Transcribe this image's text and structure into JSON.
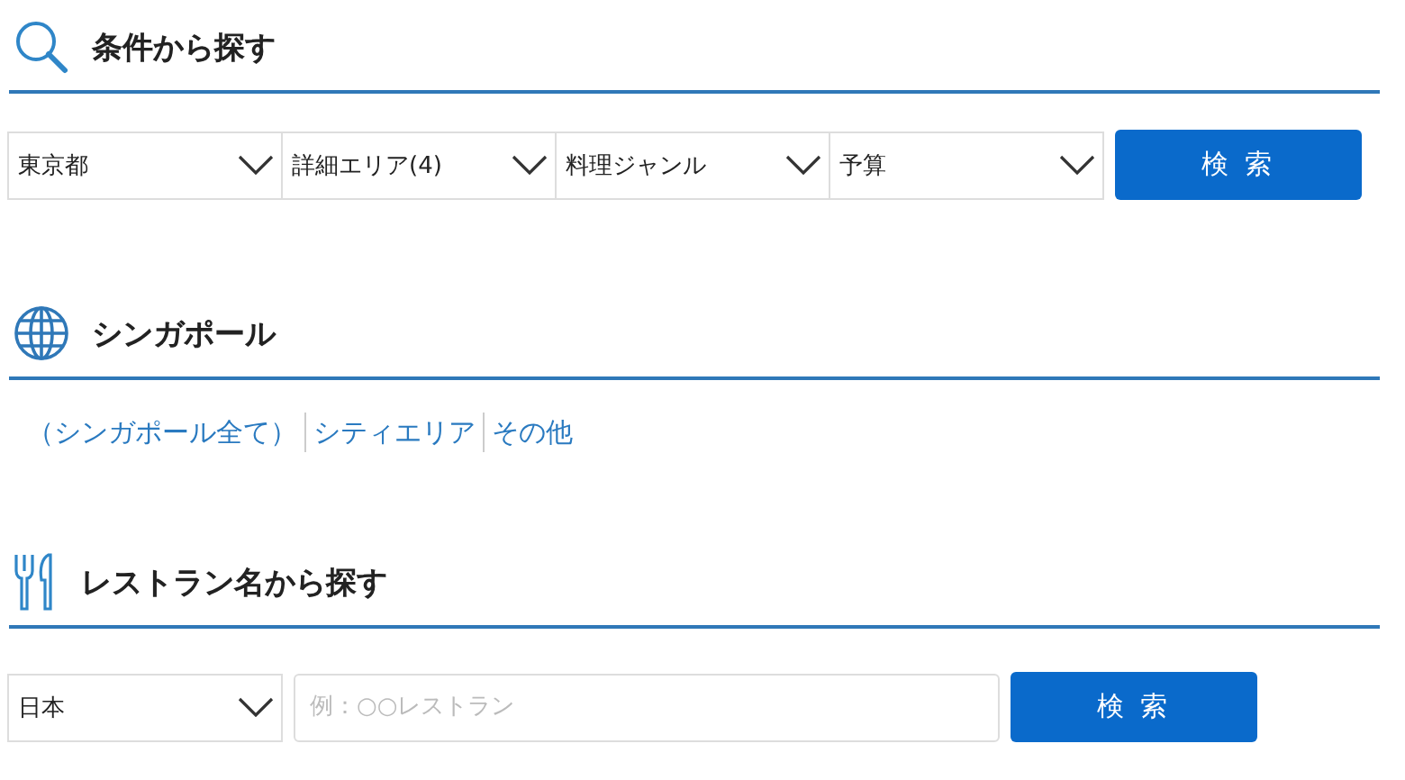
{
  "condition_search": {
    "title": "条件から探す",
    "selects": [
      {
        "value": "東京都"
      },
      {
        "value": "詳細エリア(4)"
      },
      {
        "value": "料理ジャンル"
      },
      {
        "value": "予算"
      }
    ],
    "button": "検 索"
  },
  "region": {
    "title": "シンガポール",
    "links": [
      "（シンガポール全て）",
      "シティエリア",
      "その他"
    ]
  },
  "name_search": {
    "title": "レストラン名から探す",
    "select": {
      "value": "日本"
    },
    "input": {
      "placeholder": "例：○○レストラン"
    },
    "button": "検 索"
  }
}
